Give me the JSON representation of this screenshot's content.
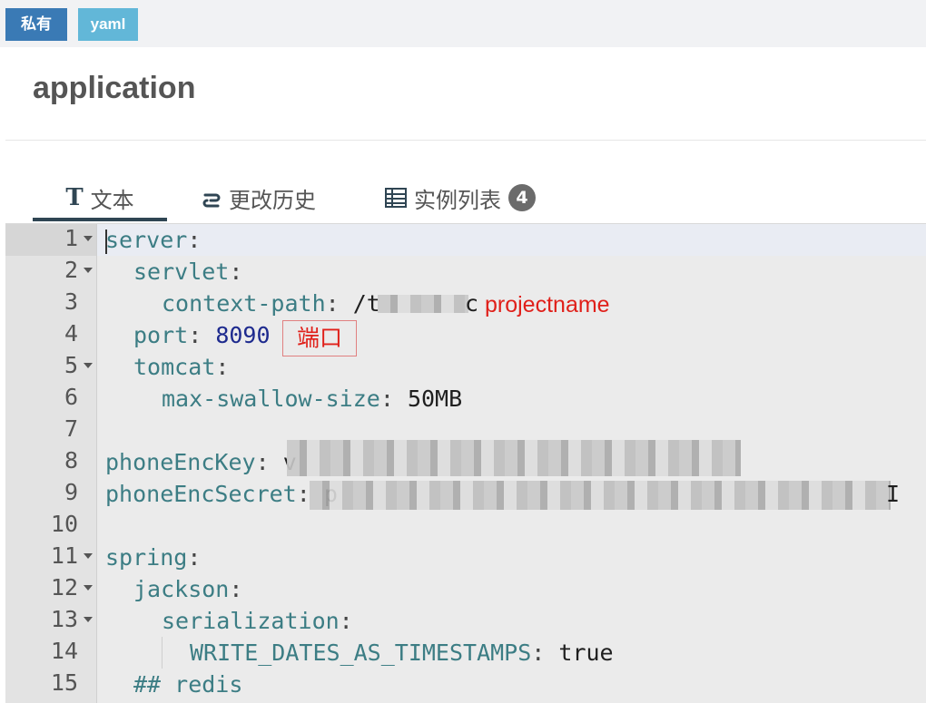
{
  "header": {
    "badge_private": "私有",
    "badge_yaml": "yaml",
    "title": "application"
  },
  "tabs": [
    {
      "label": "文本",
      "icon": "text-icon",
      "active": true
    },
    {
      "label": "更改历史",
      "icon": "history-icon",
      "active": false
    },
    {
      "label": "实例列表",
      "icon": "list-icon",
      "active": false,
      "count": "4"
    }
  ],
  "editor": {
    "line_numbers": [
      "1",
      "2",
      "3",
      "4",
      "5",
      "6",
      "7",
      "8",
      "9",
      "10",
      "11",
      "12",
      "13",
      "14",
      "15"
    ],
    "lines": [
      {
        "key": "server",
        "sep": ":"
      },
      {
        "key": "servlet",
        "sep": ":"
      },
      {
        "key": "context-path",
        "sep": ": ",
        "value": "/t",
        "value_tail": "c"
      },
      {
        "key": "port",
        "sep": ": ",
        "value": "8090"
      },
      {
        "key": "tomcat",
        "sep": ":"
      },
      {
        "key": "max-swallow-size",
        "sep": ": ",
        "value": "50MB"
      },
      {
        "key": "",
        "sep": ""
      },
      {
        "key": "phoneEncKey",
        "sep": ": ",
        "value": "v"
      },
      {
        "key": "phoneEncSecret",
        "sep": ": ",
        "value": "p",
        "value_tail": "I"
      },
      {
        "key": "",
        "sep": ""
      },
      {
        "key": "spring",
        "sep": ":"
      },
      {
        "key": "jackson",
        "sep": ":"
      },
      {
        "key": "serialization",
        "sep": ":"
      },
      {
        "key": "WRITE_DATES_AS_TIMESTAMPS",
        "sep": ": ",
        "value": "true"
      },
      {
        "comment": "## redis"
      }
    ]
  },
  "annotations": {
    "projectname": "projectname",
    "port_label": "端口"
  }
}
